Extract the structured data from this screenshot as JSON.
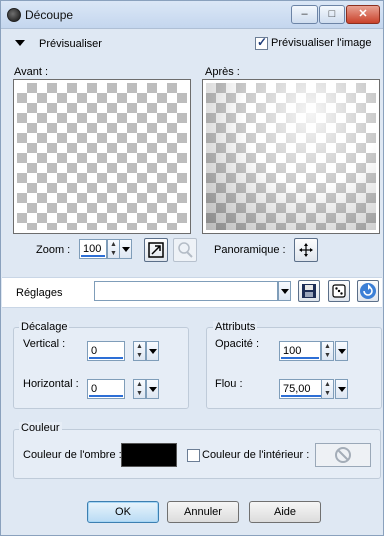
{
  "window": {
    "title": "Découpe",
    "min_glyph": "–",
    "max_glyph": "□",
    "close_glyph": "✕"
  },
  "preview": {
    "toggle_label": "Prévisualiser",
    "show_image_label": "Prévisualiser l'image",
    "show_image_checked": true,
    "before_label": "Avant :",
    "after_label": "Après :",
    "zoom_label": "Zoom :",
    "zoom_value": "100",
    "pan_label": "Panoramique :"
  },
  "settings": {
    "label": "Réglages",
    "value": ""
  },
  "offset": {
    "title": "Décalage",
    "vertical_label": "Vertical :",
    "vertical_value": "0",
    "horizontal_label": "Horizontal :",
    "horizontal_value": "0"
  },
  "attributes": {
    "title": "Attributs",
    "opacity_label": "Opacité :",
    "opacity_value": "100",
    "blur_label": "Flou :",
    "blur_value": "75,00"
  },
  "color": {
    "title": "Couleur",
    "shadow_color_label": "Couleur de l'ombre :",
    "shadow_color": "#000000",
    "inside_color_label": "Couleur de l'intérieur :",
    "inside_color_checked": false
  },
  "buttons": {
    "ok": "OK",
    "cancel": "Annuler",
    "help": "Aide"
  }
}
